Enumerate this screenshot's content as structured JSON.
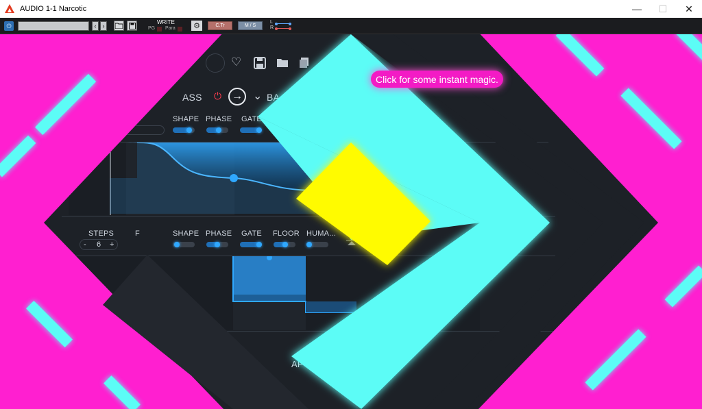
{
  "window": {
    "title": "AUDIO 1-1 Narcotic",
    "minimize_glyph": "—",
    "maximize_glyph": "☐",
    "close_glyph": "✕"
  },
  "host": {
    "power_glyph": "⏻",
    "prev_glyph": "‹",
    "next_glyph": "›",
    "folder_glyph": "📂",
    "save_glyph": "💾",
    "write_label": "WRITE",
    "pg_label": "PG",
    "para_label": "Para",
    "gear_glyph": "⚙",
    "ctr_label": "C.Tr",
    "ms_label": "M / S",
    "l_label": "L",
    "r_label": "R"
  },
  "plugin": {
    "tooltip": "Click for some instant magic.",
    "top_icons": {
      "heart": "♡",
      "save": "💾",
      "folder": "📁",
      "stack": "🗐"
    },
    "top_row": {
      "partial_label": "ASS",
      "power_glyph": "⏻",
      "arrow_glyph": "→",
      "chevron_glyph": "⌄",
      "partial_label_2": "BA"
    },
    "upper_controls": [
      {
        "label": "SHAPE",
        "level": 0.8
      },
      {
        "label": "PHASE",
        "level": 0.5
      },
      {
        "label": "GATE",
        "level": 0.8
      }
    ],
    "lower_controls": {
      "steps_label": "STEPS",
      "steps_value": "6",
      "minus": "-",
      "plus": "+",
      "partial_label": "F",
      "sliders": [
        {
          "label": "SHAPE",
          "level": 0.1
        },
        {
          "label": "PHASE",
          "level": 0.5
        },
        {
          "label": "GATE",
          "level": 0.8
        },
        {
          "label": "FLOOR",
          "level": 0.5
        },
        {
          "label": "HUMA...",
          "level": 0.1
        }
      ]
    },
    "bottom_partial": "AF"
  },
  "colors": {
    "magenta": "#ff1fd0",
    "cyan": "#5cfcf6",
    "yellow": "#fffb00",
    "panel": "#1d2127",
    "accent_blue": "#2fa8ff"
  }
}
